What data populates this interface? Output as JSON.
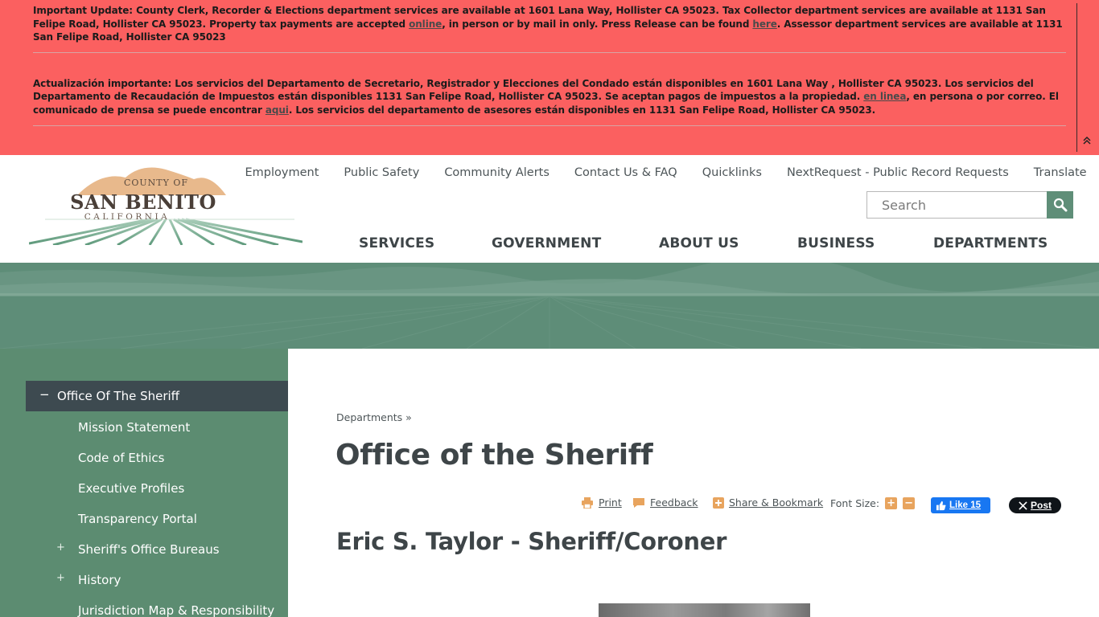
{
  "alert": {
    "en_part1": "Important Update: County Clerk, Recorder & Elections department services are available at 1601 Lana Way, Hollister CA 95023. Tax Collector department services are available at 1131 San Felipe Road, Hollister CA 95023. Property tax payments are accepted ",
    "en_link1": "online",
    "en_part2": ", in person or by mail in only. Press Release can be found ",
    "en_link2": "here",
    "en_part3": ". Assessor department services are available at 1131 San Felipe Road, Hollister CA 95023",
    "es_part1": "Actualización importante: Los servicios del Departamento de Secretario, Registrador y Elecciones del Condado están disponibles en 1601 Lana Way , Hollister CA 95023. Los servicios del Departamento de Recaudación de Impuestos están disponibles  1131 San Felipe Road, Hollister CA 95023. Se aceptan pagos de impuestos a la propiedad. ",
    "es_link1": "en linea",
    "es_part2": ", en persona o por correo. El comunicado de prensa se puede encontrar ",
    "es_link2": "aqui",
    "es_part3": ". Los servicios del departamento de asesores están disponibles en 1131 San Felipe Road, Hollister CA 95023.",
    "toggle_icon": "double-chevron-up-icon",
    "background_color": "#fb6060"
  },
  "logo": {
    "county_of": "COUNTY OF",
    "name": "SAN BENITO",
    "state": "CALIFORNIA"
  },
  "toplinks": [
    "Employment",
    "Public Safety",
    "Community Alerts",
    "Contact Us & FAQ",
    "Quicklinks",
    "NextRequest - Public Record Requests",
    "Translate"
  ],
  "search": {
    "placeholder": "Search",
    "icon": "search-icon",
    "button_color": "#5f8e78"
  },
  "mainnav": [
    "SERVICES",
    "GOVERNMENT",
    "ABOUT US",
    "BUSINESS",
    "DEPARTMENTS"
  ],
  "sidebar": {
    "active": {
      "label": "Office Of The Sheriff",
      "toggle": "−"
    },
    "items": [
      {
        "label": "Mission Statement",
        "expand": ""
      },
      {
        "label": "Code of Ethics",
        "expand": ""
      },
      {
        "label": "Executive Profiles",
        "expand": ""
      },
      {
        "label": "Transparency Portal",
        "expand": ""
      },
      {
        "label": "Sheriff's Office Bureaus",
        "expand": "+"
      },
      {
        "label": "History",
        "expand": "+"
      },
      {
        "label": "Jurisdiction Map & Responsibility",
        "expand": ""
      }
    ],
    "color": "#5c8c71"
  },
  "main": {
    "breadcrumb": {
      "link": "Departments",
      "sep": " »"
    },
    "title": "Office of the Sheriff",
    "tools": {
      "print": "Print",
      "feedback": "Feedback",
      "share": "Share & Bookmark",
      "font_size": "Font Size:",
      "increase": "+",
      "decrease": "−"
    },
    "facebook": {
      "label": "Like 15"
    },
    "x": {
      "label": "Post"
    },
    "subtitle": "Eric S. Taylor - Sheriff/Coroner"
  }
}
